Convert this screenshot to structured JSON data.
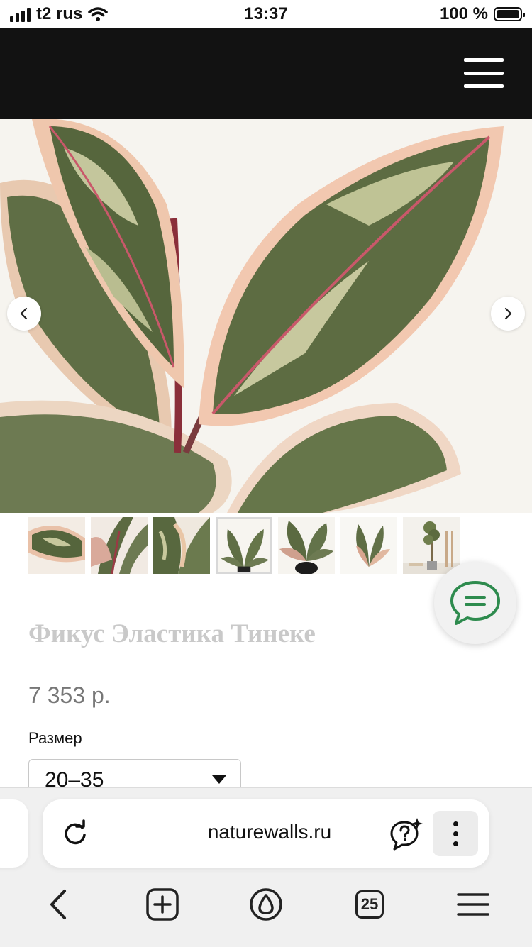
{
  "status_bar": {
    "carrier": "t2 rus",
    "time": "13:37",
    "battery": "100 %"
  },
  "product": {
    "title": "Фикус Эластика Тинеке",
    "price": "7 353 р.",
    "size_label": "Размер",
    "size_selected": "20–35"
  },
  "gallery": {
    "thumbnail_count": 7,
    "active_thumbnail": 4
  },
  "browser": {
    "url": "naturewalls.ru",
    "tabs_count": "25"
  },
  "icons": {
    "menu": "hamburger-icon",
    "prev": "chevron-left-icon",
    "next": "chevron-right-icon",
    "chat": "chat-bubble-icon",
    "reload": "reload-icon",
    "ai": "ai-question-icon",
    "more": "vertical-dots-icon",
    "back": "back-arrow-icon",
    "new_tab": "plus-square-icon",
    "home": "alice-icon",
    "menu_bottom": "hamburger-icon"
  },
  "colors": {
    "header_bg": "#121212",
    "chat_green": "#2e8b4e",
    "title_gray": "#c9c9c9"
  }
}
